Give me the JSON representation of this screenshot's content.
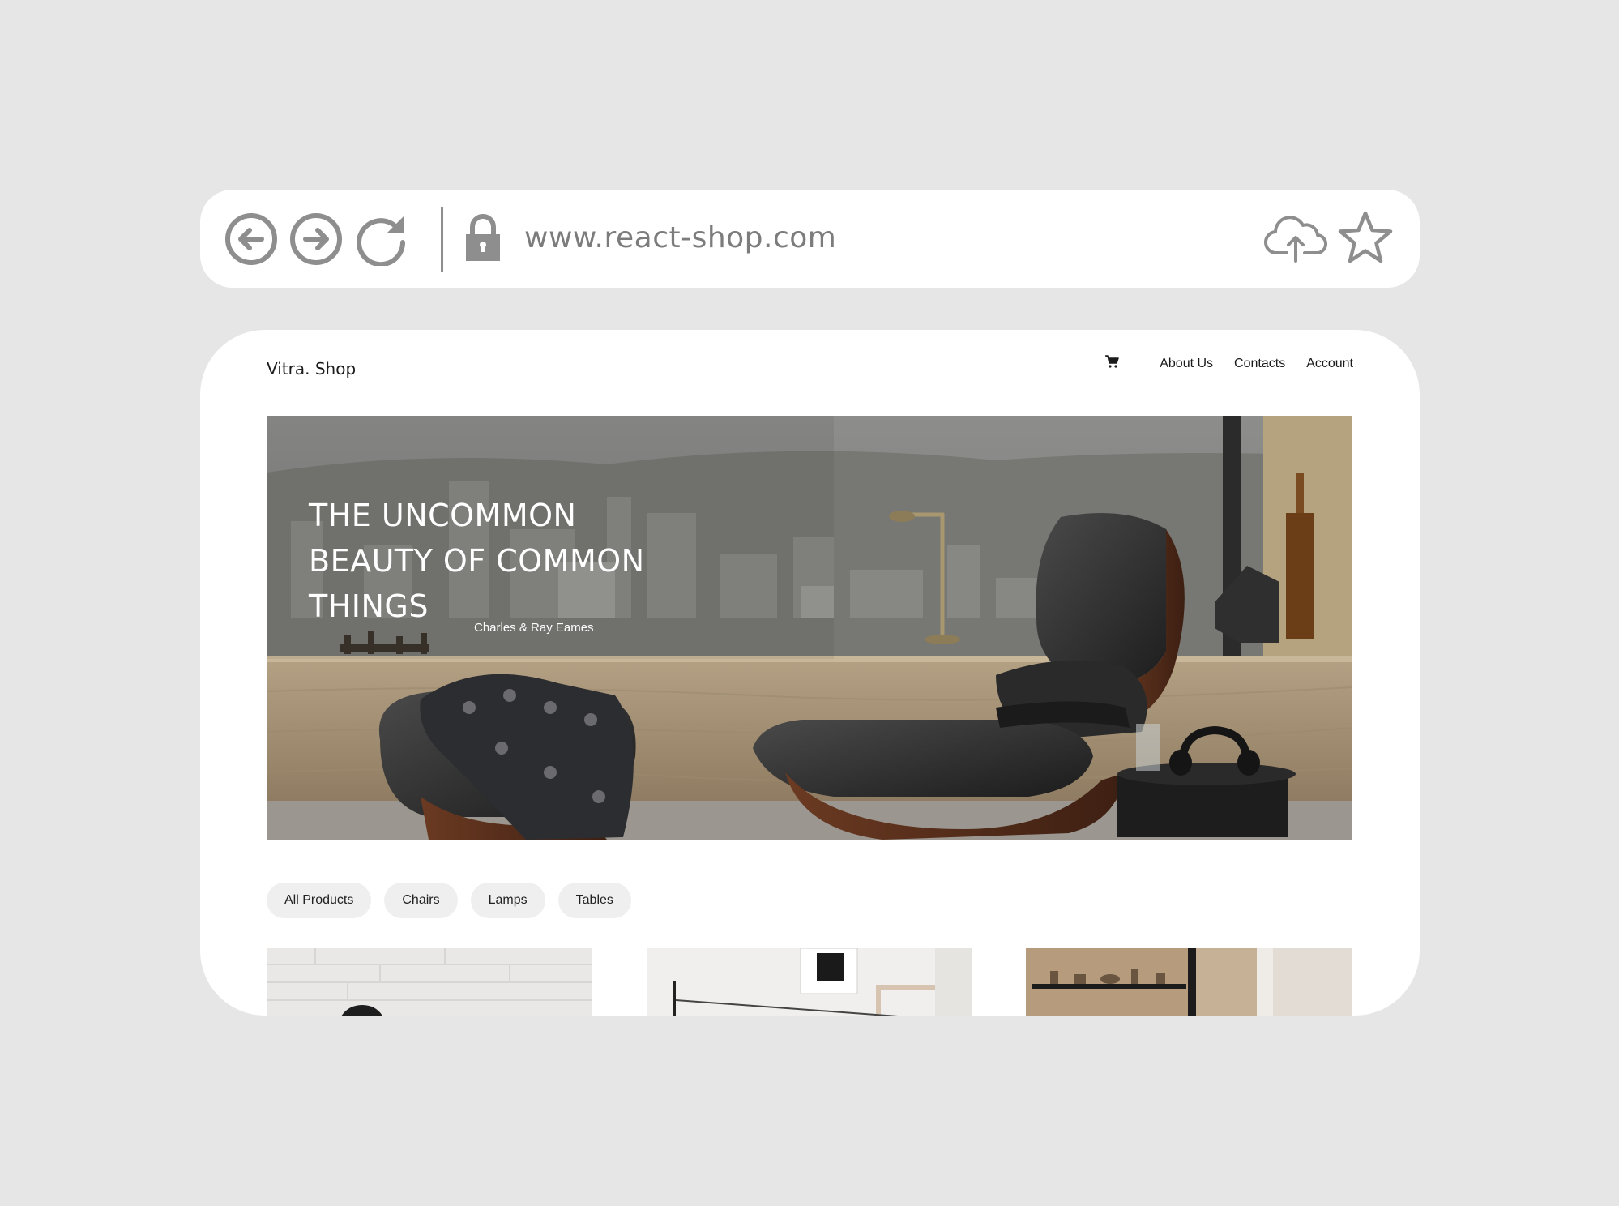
{
  "browser": {
    "url": "www.react-shop.com",
    "icons": {
      "back": "arrow-left-circle-icon",
      "forward": "arrow-right-circle-icon",
      "reload": "reload-icon",
      "lock": "lock-icon",
      "upload": "cloud-upload-icon",
      "bookmark": "star-icon"
    }
  },
  "site": {
    "logo": "Vitra. Shop",
    "nav": {
      "cart_icon": "cart-icon",
      "links": [
        "About Us",
        "Contacts",
        "Account"
      ]
    },
    "hero": {
      "title_lines": [
        "THE UNCOMMON",
        "BEAUTY OF COMMON",
        "THINGS"
      ],
      "author": "Charles & Ray Eames"
    },
    "filters": [
      "All Products",
      "Chairs",
      "Lamps",
      "Tables"
    ]
  },
  "colors": {
    "page_background": "#e6e6e6",
    "panel": "#ffffff",
    "icon_gray": "#8e8e8e",
    "pill_background": "#efefef",
    "text_dark": "#1a1a1a"
  }
}
